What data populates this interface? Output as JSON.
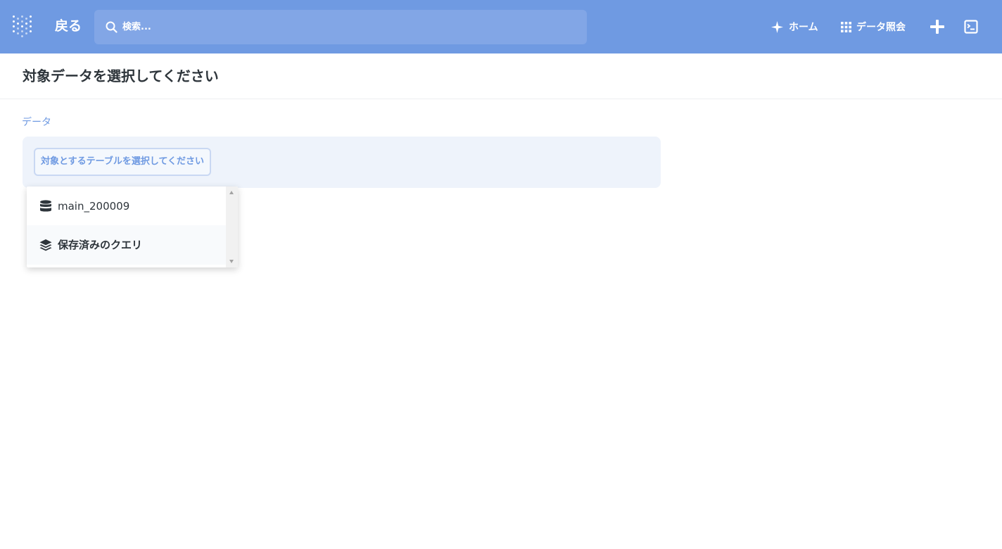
{
  "navbar": {
    "logo_icon": "metabase-dots-logo-icon",
    "back_label": "戻る",
    "search": {
      "placeholder": "検索...",
      "icon": "search-icon"
    },
    "home": {
      "icon": "sparkle-icon",
      "label": "ホーム"
    },
    "browse": {
      "icon": "grid-icon",
      "label": "データ照会"
    },
    "new_icon": "plus-icon",
    "sql_icon": "sql-editor-icon",
    "background_color": "#6f9ae2"
  },
  "page": {
    "title": "対象データを選択してください"
  },
  "data_step": {
    "label": "データ",
    "pick_button": "対象とするテーブルを選択してください"
  },
  "dropdown": {
    "options": [
      {
        "icon": "database-icon",
        "label": "main_200009"
      },
      {
        "icon": "stack-layers-icon",
        "label": "保存済みのクエリ"
      }
    ]
  },
  "colors": {
    "accent": "#6f9ae2",
    "text_dark": "#2e353b",
    "step_background": "#eef3fb"
  }
}
